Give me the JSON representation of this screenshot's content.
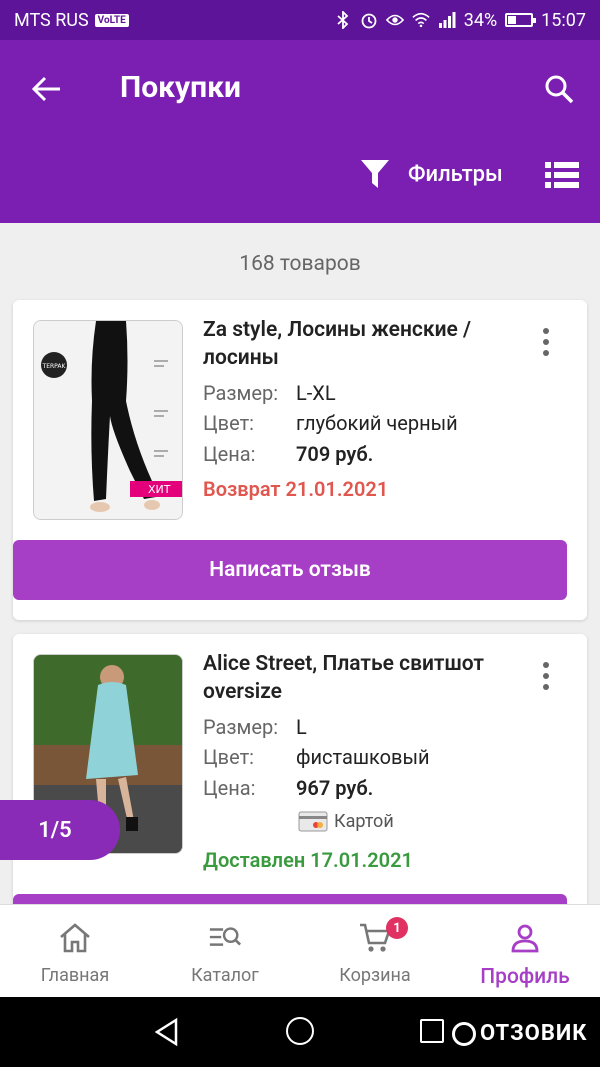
{
  "status_bar": {
    "carrier": "MTS RUS",
    "volte": "VoLTE",
    "battery_percent": "34%",
    "time": "15:07"
  },
  "header": {
    "title": "Покупки",
    "filters_label": "Фильтры"
  },
  "count_label": "168 товаров",
  "products": [
    {
      "name": "Za style, Лосины женские / лосины",
      "size_label": "Размер:",
      "size": "L-XL",
      "color_label": "Цвет:",
      "color": "глубокий черный",
      "price_label": "Цена:",
      "price": "709 руб.",
      "status": "Возврат 21.01.2021",
      "thumb_badge": "ХИТ",
      "thumb_logo": "TERPAK",
      "review_button": "Написать отзыв"
    },
    {
      "name": "Alice Street, Платье свитшот oversize",
      "size_label": "Размер:",
      "size": "L",
      "color_label": "Цвет:",
      "color": "фисташковый",
      "price_label": "Цена:",
      "price": "967 руб.",
      "payment": "Картой",
      "status": "Доставлен 17.01.2021"
    }
  ],
  "pager": "1/5",
  "bottom_nav": [
    {
      "label": "Главная",
      "icon": "home-icon"
    },
    {
      "label": "Каталог",
      "icon": "catalog-search-icon"
    },
    {
      "label": "Корзина",
      "icon": "cart-icon",
      "badge": "1"
    },
    {
      "label": "Профиль",
      "icon": "profile-icon",
      "active": true
    }
  ],
  "watermark": "ОТЗОВИК",
  "colors": {
    "status_bar": "#5e1499",
    "header": "#7b1fb3",
    "accent": "#a63fc6",
    "return_status": "#e0574f",
    "delivered_status": "#3a9a3e",
    "badge": "#e03162"
  }
}
